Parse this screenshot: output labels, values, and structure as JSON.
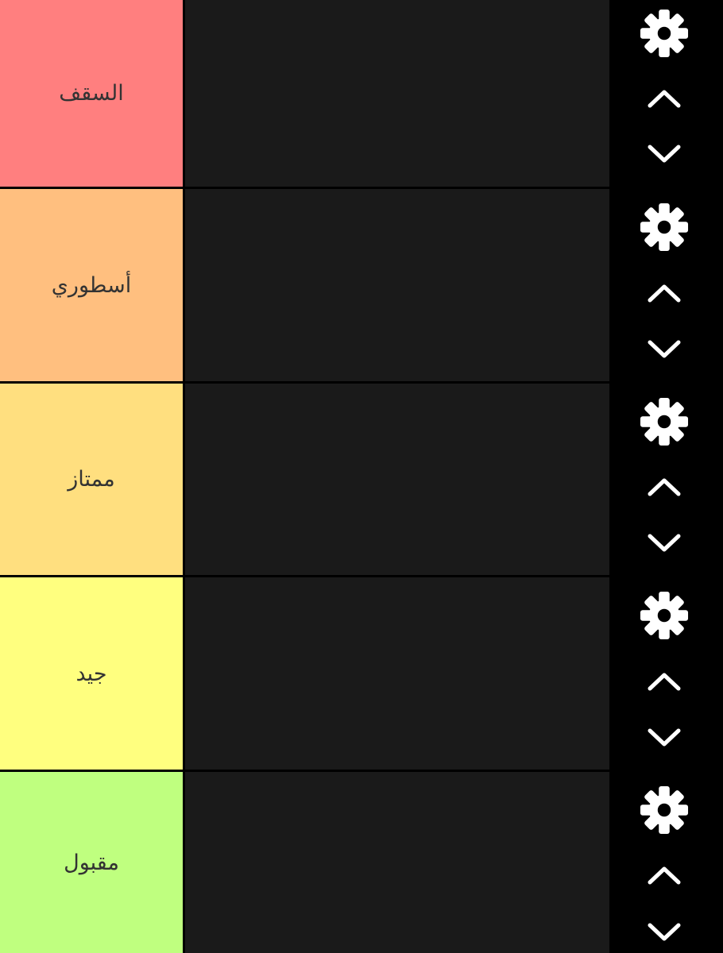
{
  "tiers": [
    {
      "label": "السقف",
      "color": "#ff7f7f"
    },
    {
      "label": "أسطوري",
      "color": "#ffbf7f"
    },
    {
      "label": "ممتاز",
      "color": "#ffdf7f"
    },
    {
      "label": "جيد",
      "color": "#ffff7f"
    },
    {
      "label": "مقبول",
      "color": "#bfff7f"
    }
  ],
  "controls": {
    "settings_icon": "gear-icon",
    "move_up_icon": "chevron-up-icon",
    "move_down_icon": "chevron-down-icon"
  },
  "colors": {
    "dropzone": "#1a1a1a",
    "background": "#000000",
    "icon": "#ffffff"
  }
}
